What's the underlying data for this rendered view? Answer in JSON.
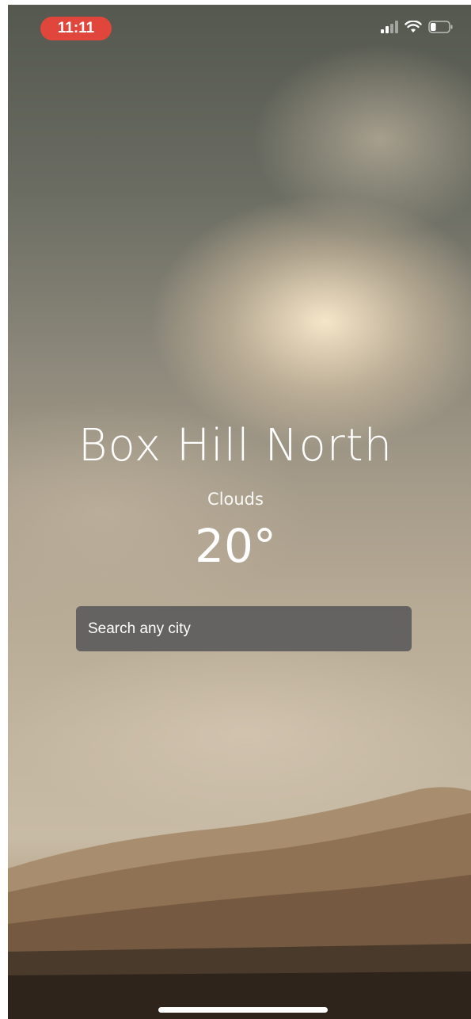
{
  "status_bar": {
    "time": "11:11",
    "icons": [
      "signal-icon",
      "wifi-icon",
      "battery-icon"
    ],
    "time_pill_color": "#e0463b",
    "battery_level": 0.3
  },
  "weather": {
    "city": "Box Hill North",
    "condition": "Clouds",
    "temperature": "20°"
  },
  "search": {
    "placeholder": "Search any city",
    "value": ""
  },
  "colors": {
    "text": "#ffffff",
    "search_background": "#5c5c5c"
  }
}
